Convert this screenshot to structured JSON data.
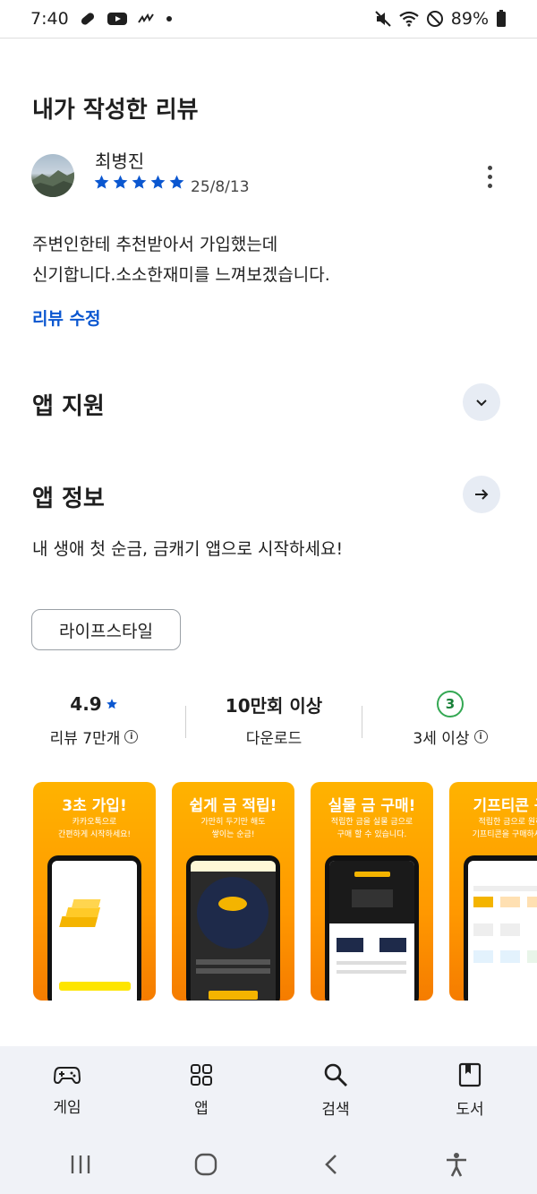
{
  "status_bar": {
    "time": "7:40",
    "battery": "89%",
    "icons_left": [
      "pill-icon",
      "youtube-icon",
      "squiggle-icon",
      "dot-icon"
    ],
    "icons_right": [
      "mute-icon",
      "wifi-icon",
      "dnd-icon",
      "battery-icon"
    ]
  },
  "my_review": {
    "section_title": "내가 작성한 리뷰",
    "reviewer_name": "최병진",
    "rating": 5,
    "date": "25/8/13",
    "text_line1": "주변인한테 추천받아서 가입했는데",
    "text_line2": "신기합니다.소소한재미를 느껴보겠습니다.",
    "edit_label": "리뷰 수정"
  },
  "app_support": {
    "title": "앱 지원"
  },
  "app_info": {
    "title": "앱 정보",
    "description": "내 생애 첫 순금, 금캐기 앱으로 시작하세요!",
    "category_chip": "라이프스타일"
  },
  "stats": {
    "rating": "4.9",
    "reviews_label": "리뷰 7만개",
    "downloads": "10만회 이상",
    "downloads_label": "다운로드",
    "age_rating": "3",
    "age_label": "3세 이상"
  },
  "screenshots": [
    {
      "title": "3초 가입!",
      "subtitle": "카카오톡으로\n간편하게 시작하세요!"
    },
    {
      "title": "쉽게 금 적립!",
      "subtitle": "가만히 두기만 해도\n쌓이는 순금!"
    },
    {
      "title": "실물 금 구매!",
      "subtitle": "적립한 금을 실물 금으로\n구매 할 수 있습니다."
    },
    {
      "title": "기프티콘 구",
      "subtitle": "적립한 금으로 원하\n기프티콘을 구매하세요"
    }
  ],
  "bottom_nav": {
    "items": [
      {
        "label": "게임",
        "icon": "gamepad-icon"
      },
      {
        "label": "앱",
        "icon": "apps-grid-icon"
      },
      {
        "label": "검색",
        "icon": "search-icon"
      },
      {
        "label": "도서",
        "icon": "book-icon"
      }
    ]
  },
  "colors": {
    "accent_blue": "#0b57d0",
    "nav_background": "#f0f2f7",
    "badge_green": "#34a853",
    "screenshot_orange": "#ff9800"
  }
}
